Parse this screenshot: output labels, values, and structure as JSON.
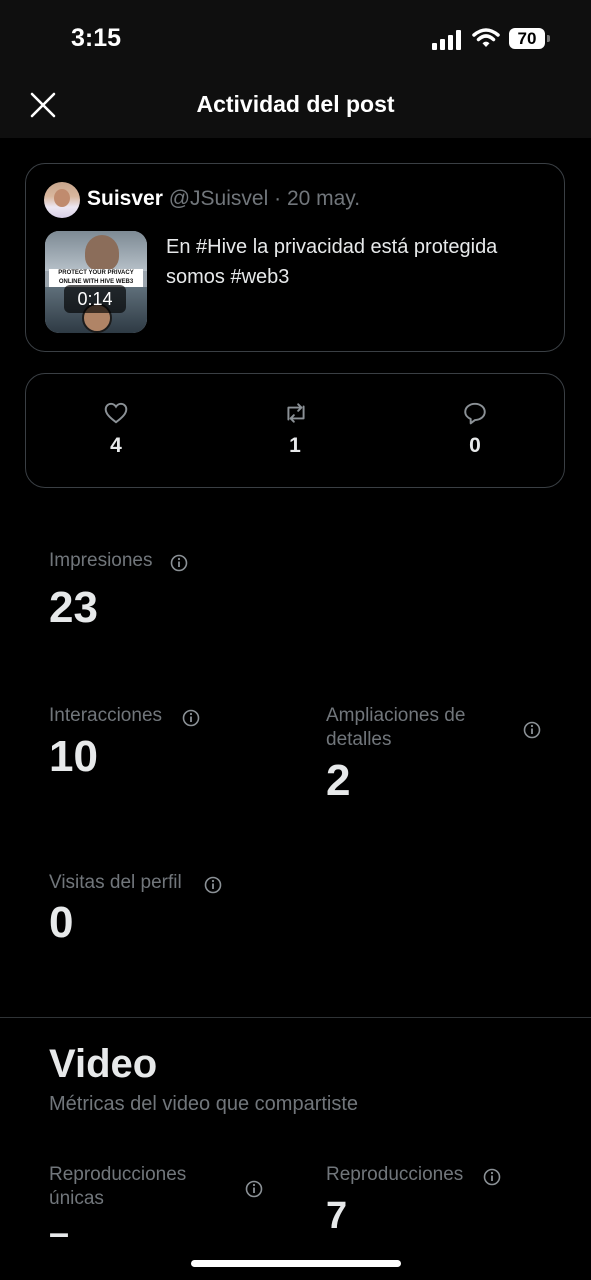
{
  "status_bar": {
    "time": "3:15",
    "battery": "70"
  },
  "header": {
    "title": "Actividad del post"
  },
  "post": {
    "author_name": "Suisver",
    "author_handle": "@JSuisvel",
    "separator": "·",
    "date": "20 may.",
    "thumbnail_text": "PROTECT YOUR PRIVACY ONLINE WITH HIVE WEB3",
    "video_duration": "0:14",
    "text": "En #Hive la privacidad está protegida somos #web3"
  },
  "engagement": {
    "likes": "4",
    "reposts": "1",
    "replies": "0"
  },
  "metrics": {
    "impressions_label": "Impresiones",
    "impressions_value": "23",
    "interactions_label": "Interacciones",
    "interactions_value": "10",
    "detail_expands_label": "Ampliaciones de detalles",
    "detail_expands_value": "2",
    "profile_visits_label": "Visitas del perfil",
    "profile_visits_value": "0"
  },
  "video_section": {
    "title": "Video",
    "subtitle": "Métricas del video que compartiste",
    "unique_plays_label": "Reproducciones únicas",
    "unique_plays_value": "–",
    "plays_label": "Reproducciones",
    "plays_value": "7"
  },
  "icons": {
    "close": "close-icon",
    "like": "heart-icon",
    "repost": "repost-icon",
    "reply": "reply-icon",
    "info": "info-icon"
  }
}
